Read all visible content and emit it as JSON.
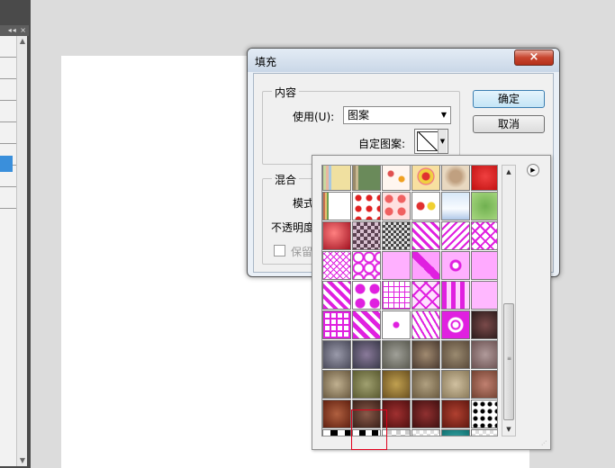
{
  "left_panel": {
    "collapse_label": "◂◂",
    "close_label": "×"
  },
  "dialog": {
    "title": "填充",
    "close_label": "×",
    "contents_group": "内容",
    "use_label": "使用(U):",
    "use_value": "图案",
    "custom_pattern_label": "自定图案:",
    "blend_group": "混合",
    "mode_label": "模式",
    "opacity_label": "不透明度",
    "preserve_label": "保留透",
    "ok_label": "确定",
    "cancel_label": "取消"
  },
  "pattern_picker": {
    "selected_index": 55,
    "patterns": [
      {
        "name": "stripes",
        "bg": "linear-gradient(90deg,#c8d8a0 0 3px,#e8b8a0 3px 6px,#a8c8e0 6px 9px,#f0e0a0 9px 12px)"
      },
      {
        "name": "stripes2",
        "bg": "linear-gradient(90deg,#9a8a6a 0 3px,#c8b890 3px 6px,#6a8a5a 6px 9px)"
      },
      {
        "name": "flowers",
        "bg": "radial-gradient(circle at 30% 40%,#e05050 3px,transparent 4px),radial-gradient(circle at 70% 60%,#f0a020 3px,transparent 4px),#fff6f0"
      },
      {
        "name": "rings",
        "bg": "radial-gradient(circle at 50% 50%,#e03030 4px,#f0d040 5px 8px,#f06090 9px,transparent 10px),#f8e0a0"
      },
      {
        "name": "twirl",
        "bg": "radial-gradient(circle,#c0a080 30%,#e8d8c0 60%)"
      },
      {
        "name": "red",
        "bg": "radial-gradient(circle,#f04040,#c01010)"
      },
      {
        "name": "stripes3",
        "bg": "linear-gradient(90deg,#c87050 0 2px,#e8c070 2px 4px,#70a050 4px 6px,#fff 6px 8px)"
      },
      {
        "name": "dots-red",
        "bg": "radial-gradient(circle at 50% 50%,#e02020 3px,transparent 4px) 0 0/12px 12px,#fff"
      },
      {
        "name": "hearts-red",
        "bg": "radial-gradient(circle,#f06060 4px,transparent 5px) 0 0/14px 14px,#ffe0e0"
      },
      {
        "name": "fruit",
        "bg": "radial-gradient(circle at 30% 50%,#e03030 4px,transparent 5px),radial-gradient(circle at 70% 50%,#f0d030 4px,transparent 5px),#fff"
      },
      {
        "name": "cloud",
        "bg": "linear-gradient(#d8e8f8,#f8fbff 60%,#b0c8e8)"
      },
      {
        "name": "leaves",
        "bg": "radial-gradient(circle,#70b050,#a8d880)"
      },
      {
        "name": "red-bubbles",
        "bg": "radial-gradient(circle at 40% 40%,#ff8080,#a01020)"
      },
      {
        "name": "checker-mauve",
        "bg": "repeating-conic-gradient(#5a4050 0 25%,#d8c0d0 0 50%) 0 0/8px 8px"
      },
      {
        "name": "lace-grey",
        "bg": "repeating-conic-gradient(#444 0 25%,#ddd 0 50%) 0 0/6px 6px"
      },
      {
        "name": "diag-magenta",
        "bg": "repeating-linear-gradient(45deg,#e020e0 0 3px,#fff 3px 7px)"
      },
      {
        "name": "zigzag-mag",
        "bg": "repeating-linear-gradient(-45deg,#e020e0 0 2px,#fff 2px 6px)"
      },
      {
        "name": "x-mag",
        "bg": "repeating-linear-gradient(45deg,#e020e0 0 2px,transparent 2px 8px),repeating-linear-gradient(-45deg,#e020e0 0 2px,#fff 2px 8px)"
      },
      {
        "name": "mag-lattice",
        "bg": "repeating-linear-gradient(45deg,#e020e0 0 1px,transparent 1px 5px),repeating-linear-gradient(-45deg,#e020e0 0 1px,#fff 1px 5px)"
      },
      {
        "name": "mag-wave",
        "bg": "radial-gradient(circle,transparent 4px,#e020e0 5px 6px,transparent 7px) 0 0/12px 12px,#fff"
      },
      {
        "name": "mag-solid",
        "bg": "#ffb0ff"
      },
      {
        "name": "mag-diagblock",
        "bg": "linear-gradient(45deg,#ffa0ff 40%,#e020e0 40% 60%,#ffa0ff 60%)"
      },
      {
        "name": "mag-square",
        "bg": "radial-gradient(circle,#fff 3px,#e020e0 4px 6px,#ffb0ff 7px)"
      },
      {
        "name": "mag-pink",
        "bg": "#ffaaff"
      },
      {
        "name": "mag-diag2",
        "bg": "repeating-linear-gradient(45deg,#e020e0 0 4px,#fff 4px 8px)"
      },
      {
        "name": "mag-circles",
        "bg": "radial-gradient(circle,#e020e0 5px,transparent 6px) 0 0/16px 16px,#fff"
      },
      {
        "name": "mag-grid",
        "bg": "repeating-linear-gradient(0deg,#e020e0 0 1px,transparent 1px 6px),repeating-linear-gradient(90deg,#e020e0 0 1px,#fff 1px 6px)"
      },
      {
        "name": "mag-x",
        "bg": "repeating-linear-gradient(45deg,#e020e0 0 2px,transparent 2px 10px),repeating-linear-gradient(-45deg,#e020e0 0 2px,#ffe0ff 2px 10px)"
      },
      {
        "name": "mag-bars",
        "bg": "repeating-linear-gradient(90deg,#e020e0 0 5px,#ffd0ff 5px 10px)"
      },
      {
        "name": "mag-soft",
        "bg": "#ffb8ff"
      },
      {
        "name": "mag-maze",
        "bg": "repeating-linear-gradient(0deg,#e020e0 0 2px,transparent 2px 7px),repeating-linear-gradient(90deg,#e020e0 0 2px,#fff 2px 7px)"
      },
      {
        "name": "mag-stripe",
        "bg": "repeating-linear-gradient(45deg,#e020e0 0 5px,#fff 5px 9px)"
      },
      {
        "name": "mag-heart",
        "bg": "radial-gradient(circle,#e020e0 3px,transparent 4px) 50% 50%/32px 32px,#fff"
      },
      {
        "name": "mag-weave",
        "bg": "repeating-linear-gradient(60deg,#e020e0 0 2px,#fff 2px 6px)"
      },
      {
        "name": "mag-swirl",
        "bg": "radial-gradient(circle,#fff 3px,#e020e0 4px 5px,#fff 6px 8px,#e020e0 9px)"
      },
      {
        "name": "dark-floral",
        "bg": "radial-gradient(circle,#7a4a4a,#2a1a1a)"
      },
      {
        "name": "grey-floral",
        "bg": "radial-gradient(circle,#9a9aaa,#4a4a5a)"
      },
      {
        "name": "purple-dark",
        "bg": "radial-gradient(circle,#8a7a9a,#3a3a4a)"
      },
      {
        "name": "grey-lace",
        "bg": "radial-gradient(circle,#a0a098,#5a5a50)"
      },
      {
        "name": "brown-tile",
        "bg": "radial-gradient(circle,#a08a70,#4a3a30)"
      },
      {
        "name": "olive-tile",
        "bg": "radial-gradient(circle,#9a8a70,#5a4a3a)"
      },
      {
        "name": "mauve-tile",
        "bg": "radial-gradient(circle,#b09a9a,#6a5050)"
      },
      {
        "name": "tan-tile",
        "bg": "radial-gradient(circle,#c0b090,#6a5a40)"
      },
      {
        "name": "olive-lace",
        "bg": "radial-gradient(circle,#a0a070,#5a5a30)"
      },
      {
        "name": "gold-tile",
        "bg": "radial-gradient(circle,#c0a050,#6a5020)"
      },
      {
        "name": "khaki-tile",
        "bg": "radial-gradient(circle,#b0a080,#6a5a40)"
      },
      {
        "name": "beige-tile",
        "bg": "radial-gradient(circle,#d0c0a0,#8a7a5a)"
      },
      {
        "name": "rose-tile",
        "bg": "radial-gradient(circle,#c08070,#704030)"
      },
      {
        "name": "rust-tile",
        "bg": "radial-gradient(circle,#b06040,#602010)"
      },
      {
        "name": "brown-lace",
        "bg": "radial-gradient(circle,#8a5a4a,#3a2018)"
      },
      {
        "name": "red-dark",
        "bg": "radial-gradient(circle,#a03030,#501010)"
      },
      {
        "name": "maroon",
        "bg": "radial-gradient(circle,#903030,#401010)"
      },
      {
        "name": "brick",
        "bg": "radial-gradient(circle,#b04030,#601810)"
      },
      {
        "name": "dots-bw",
        "bg": "radial-gradient(circle,#000 2px,transparent 3px) 0 0/8px 8px,#fff"
      },
      {
        "name": "checker-bw-a",
        "bg": "repeating-conic-gradient(#000 0 25%,#fff 0 50%) 0 0/16px 16px"
      },
      {
        "name": "checker-bw-b",
        "bg": "repeating-conic-gradient(#000 0 25%,#fff 0 50%) 0 0/14px 14px"
      },
      {
        "name": "checker-light",
        "bg": "repeating-conic-gradient(#ccc 0 25%,#fff 0 50%) 0 0/10px 10px"
      },
      {
        "name": "checker-light2",
        "bg": "repeating-conic-gradient(#ddd 0 25%,#fff 0 50%) 0 0/8px 8px"
      },
      {
        "name": "teal",
        "bg": "radial-gradient(circle,#40b0b0,#107070)"
      },
      {
        "name": "checker-light3",
        "bg": "repeating-conic-gradient(#ddd 0 25%,#fff 0 50%) 0 0/8px 8px"
      }
    ]
  }
}
